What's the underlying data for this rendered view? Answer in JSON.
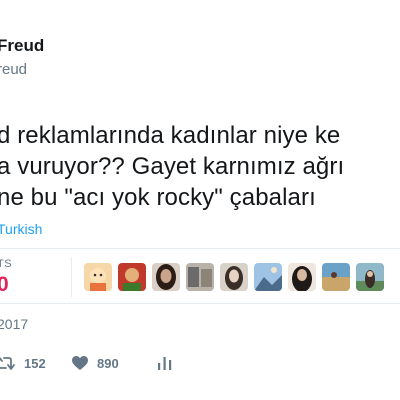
{
  "user": {
    "name": "Freud",
    "handle": "reud"
  },
  "tweet": {
    "lines": [
      "d reklamlarında kadınlar niye ke",
      "a vuruyor?? Gayet karnımız ağrı",
      " ne bu \"acı yok rocky\" çabaları"
    ]
  },
  "translate_label": "Turkish",
  "stats": {
    "label": "TS",
    "value": "0"
  },
  "avatars": [
    {
      "icon": "avatar-cartoon-icon",
      "colors": [
        "#f6d7a7",
        "#e8743b"
      ]
    },
    {
      "icon": "avatar-red-cartoon-icon",
      "colors": [
        "#c0392b",
        "#3b7a2a"
      ]
    },
    {
      "icon": "avatar-woman-dark-hair-icon",
      "colors": [
        "#2b1d16",
        "#caa58c"
      ]
    },
    {
      "icon": "avatar-photo-group-icon",
      "colors": [
        "#6b6b6b",
        "#b9b2a8"
      ]
    },
    {
      "icon": "avatar-woman-portrait-icon",
      "colors": [
        "#d9d2c9",
        "#3a2e28"
      ]
    },
    {
      "icon": "avatar-landscape-icon",
      "colors": [
        "#9fc3e5",
        "#4a6b8a"
      ]
    },
    {
      "icon": "avatar-woman-long-hair-icon",
      "colors": [
        "#1f1a17",
        "#d8b9a0"
      ]
    },
    {
      "icon": "avatar-beach-icon",
      "colors": [
        "#6aa1c9",
        "#c9a56a"
      ]
    },
    {
      "icon": "avatar-woman-outdoor-icon",
      "colors": [
        "#8fb8c9",
        "#3a2d26"
      ]
    }
  ],
  "date": "2017",
  "actions": {
    "retweets": "152",
    "likes": "890"
  },
  "colors": {
    "like_accent": "#e0245e",
    "link": "#1da1f2",
    "muted": "#657786"
  }
}
